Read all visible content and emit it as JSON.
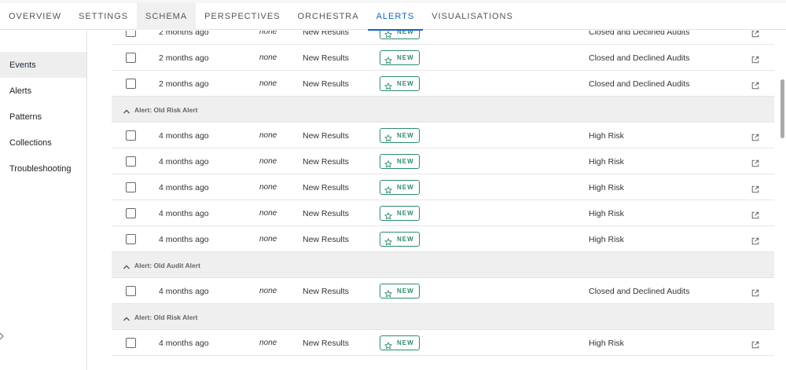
{
  "tabs": [
    {
      "label": "OVERVIEW"
    },
    {
      "label": "SETTINGS"
    },
    {
      "label": "SCHEMA"
    },
    {
      "label": "PERSPECTIVES"
    },
    {
      "label": "ORCHESTRA"
    },
    {
      "label": "ALERTS"
    },
    {
      "label": "VISUALISATIONS"
    }
  ],
  "active_tab": "ALERTS",
  "sidebar": {
    "items": [
      {
        "label": "Events"
      },
      {
        "label": "Alerts"
      },
      {
        "label": "Patterns"
      },
      {
        "label": "Collections"
      },
      {
        "label": "Troubleshooting"
      }
    ],
    "active": "Events"
  },
  "rows": [
    {
      "time": "2 months ago",
      "assignee": "none",
      "type": "New Results",
      "status": "NEW",
      "name": "Closed and Declined Audits"
    },
    {
      "time": "2 months ago",
      "assignee": "none",
      "type": "New Results",
      "status": "NEW",
      "name": "Closed and Declined Audits"
    },
    {
      "time": "2 months ago",
      "assignee": "none",
      "type": "New Results",
      "status": "NEW",
      "name": "Closed and Declined Audits"
    },
    {
      "group": "Alert: Old Risk Alert"
    },
    {
      "time": "4 months ago",
      "assignee": "none",
      "type": "New Results",
      "status": "NEW",
      "name": "High Risk"
    },
    {
      "time": "4 months ago",
      "assignee": "none",
      "type": "New Results",
      "status": "NEW",
      "name": "High Risk"
    },
    {
      "time": "4 months ago",
      "assignee": "none",
      "type": "New Results",
      "status": "NEW",
      "name": "High Risk"
    },
    {
      "time": "4 months ago",
      "assignee": "none",
      "type": "New Results",
      "status": "NEW",
      "name": "High Risk"
    },
    {
      "time": "4 months ago",
      "assignee": "none",
      "type": "New Results",
      "status": "NEW",
      "name": "High Risk"
    },
    {
      "group": "Alert: Old Audit Alert"
    },
    {
      "time": "4 months ago",
      "assignee": "none",
      "type": "New Results",
      "status": "NEW",
      "name": "Closed and Declined Audits"
    },
    {
      "group": "Alert: Old Risk Alert"
    },
    {
      "time": "4 months ago",
      "assignee": "none",
      "type": "New Results",
      "status": "NEW",
      "name": "High Risk"
    }
  ],
  "colors": {
    "accent": "#1565c0",
    "badge": "#2e8b6f"
  },
  "icons": {
    "status": "star-icon",
    "row_action": "external-link-icon",
    "group_toggle": "chevron-up-icon"
  }
}
